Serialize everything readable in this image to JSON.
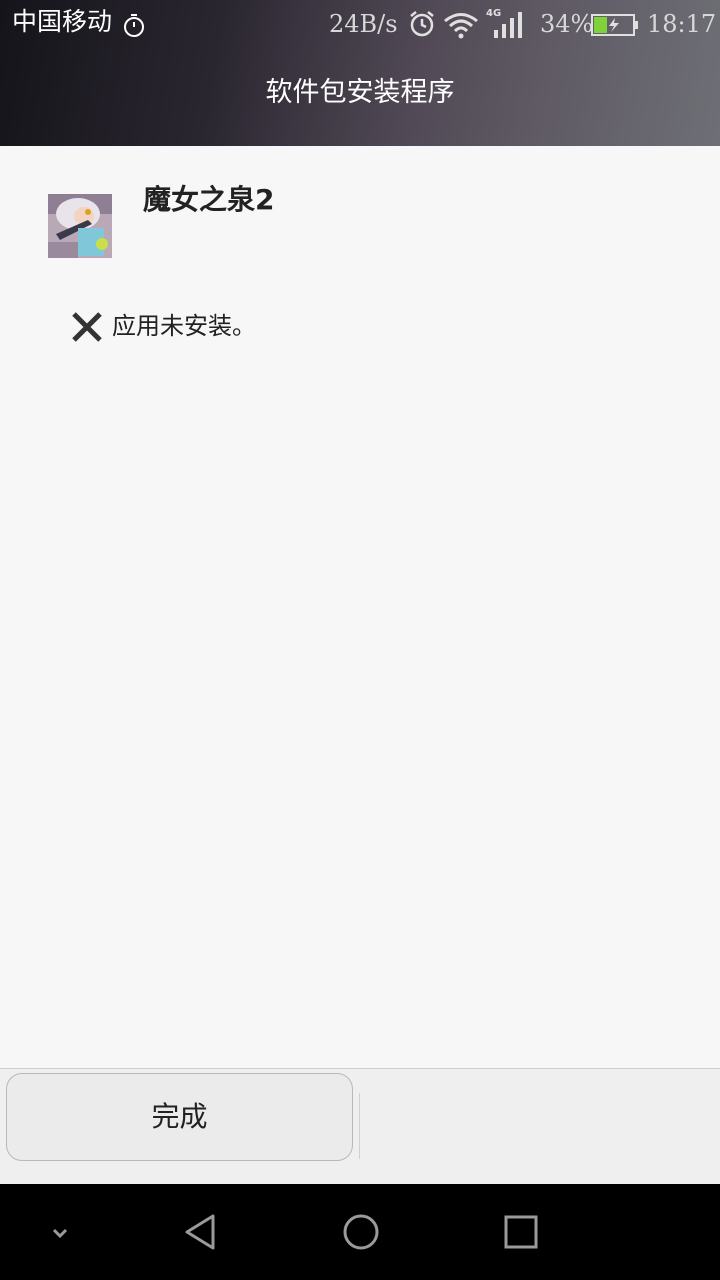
{
  "status_bar": {
    "carrier": "中国移动",
    "net_speed": "24B/s",
    "network_type": "4G",
    "battery_percent": "34%",
    "battery_level": 0.34,
    "time": "18:17",
    "icons": [
      "timer-icon",
      "alarm-icon",
      "wifi-icon",
      "signal-icon",
      "battery-charging-icon"
    ]
  },
  "header": {
    "title": "软件包安装程序"
  },
  "app": {
    "name": "魔女之泉2"
  },
  "install_status": {
    "icon": "close-icon",
    "message": "应用未安装。"
  },
  "footer": {
    "done_label": "完成"
  },
  "navbar": {
    "icons": [
      "chevron-down-icon",
      "back-icon",
      "home-icon",
      "recents-icon"
    ]
  },
  "colors": {
    "background": "#f7f7f7",
    "footer": "#efefef",
    "text": "#222222",
    "battery_fill": "#7fd23a"
  }
}
